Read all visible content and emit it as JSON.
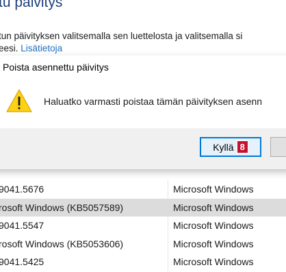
{
  "background": {
    "title": "tu päivitys",
    "description_line1": "tun päivityksen valitsemalla sen luettelosta ja valitsemalla si",
    "description_line2_prefix": "eesi.",
    "link_label": "Lisätietoja",
    "updates": [
      {
        "name": "9041.5676",
        "program": "Microsoft Windows",
        "selected": false
      },
      {
        "name": "rosoft Windows (KB5057589)",
        "program": "Microsoft Windows",
        "selected": true
      },
      {
        "name": "9041.5547",
        "program": "Microsoft Windows",
        "selected": false
      },
      {
        "name": "rosoft Windows (KB5053606)",
        "program": "Microsoft Windows",
        "selected": false
      },
      {
        "name": "9041.5425",
        "program": "Microsoft Windows",
        "selected": false
      }
    ]
  },
  "dialog": {
    "title": "Poista asennettu päivitys",
    "message": "Haluatko varmasti poistaa tämän päivityksen asenn",
    "icon": "warning-icon",
    "yes_label": "Kyllä",
    "no_label": "",
    "step_badge": "8",
    "accent_color": "#0078d7",
    "badge_color": "#c8102e"
  }
}
